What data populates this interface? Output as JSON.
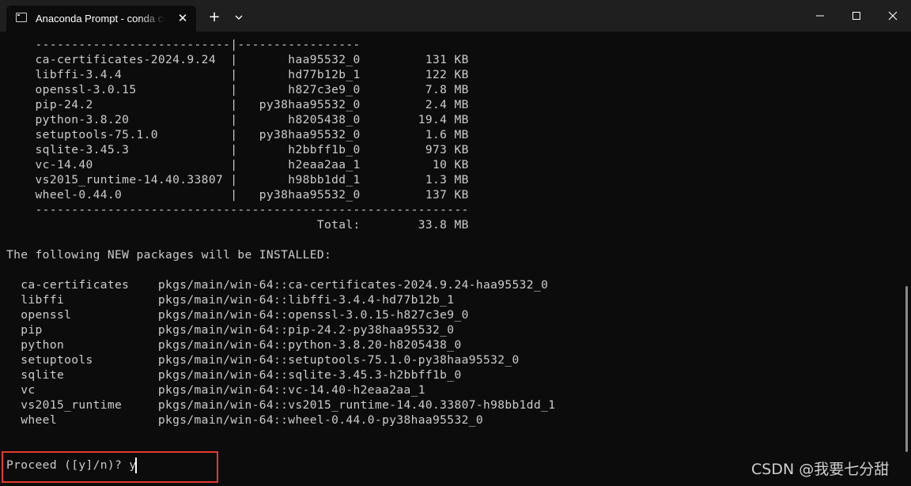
{
  "window": {
    "tab_title": "Anaconda Prompt - conda create",
    "tab_close": "✕",
    "new_tab": "+",
    "dropdown_icon": "chevron-down-icon"
  },
  "terminal": {
    "lines": [
      "    ---------------------------|-----------------",
      "    ca-certificates-2024.9.24  |       haa95532_0         131 KB",
      "    libffi-3.4.4               |       hd77b12b_1         122 KB",
      "    openssl-3.0.15             |       h827c3e9_0         7.8 MB",
      "    pip-24.2                   |   py38haa95532_0         2.4 MB",
      "    python-3.8.20              |       h8205438_0        19.4 MB",
      "    setuptools-75.1.0          |   py38haa95532_0         1.6 MB",
      "    sqlite-3.45.3              |       h2bbff1b_0         973 KB",
      "    vc-14.40                   |       h2eaa2aa_1          10 KB",
      "    vs2015_runtime-14.40.33807 |       h98bb1dd_1         1.3 MB",
      "    wheel-0.44.0               |   py38haa95532_0         137 KB",
      "    ------------------------------------------------------------",
      "                                           Total:        33.8 MB",
      "",
      "The following NEW packages will be INSTALLED:",
      "",
      "  ca-certificates    pkgs/main/win-64::ca-certificates-2024.9.24-haa95532_0",
      "  libffi             pkgs/main/win-64::libffi-3.4.4-hd77b12b_1",
      "  openssl            pkgs/main/win-64::openssl-3.0.15-h827c3e9_0",
      "  pip                pkgs/main/win-64::pip-24.2-py38haa95532_0",
      "  python             pkgs/main/win-64::python-3.8.20-h8205438_0",
      "  setuptools         pkgs/main/win-64::setuptools-75.1.0-py38haa95532_0",
      "  sqlite             pkgs/main/win-64::sqlite-3.45.3-h2bbff1b_0",
      "  vc                 pkgs/main/win-64::vc-14.40-h2eaa2aa_1",
      "  vs2015_runtime     pkgs/main/win-64::vs2015_runtime-14.40.33807-h98bb1dd_1",
      "  wheel              pkgs/main/win-64::wheel-0.44.0-py38haa95532_0",
      "",
      "",
      "Proceed ([y]/n)? y"
    ]
  },
  "watermark": "CSDN @我要七分甜",
  "colors": {
    "background": "#0c0c0c",
    "text": "#cccccc",
    "highlight_border": "#e53a2f",
    "titlebar": "#1f1f1f"
  }
}
